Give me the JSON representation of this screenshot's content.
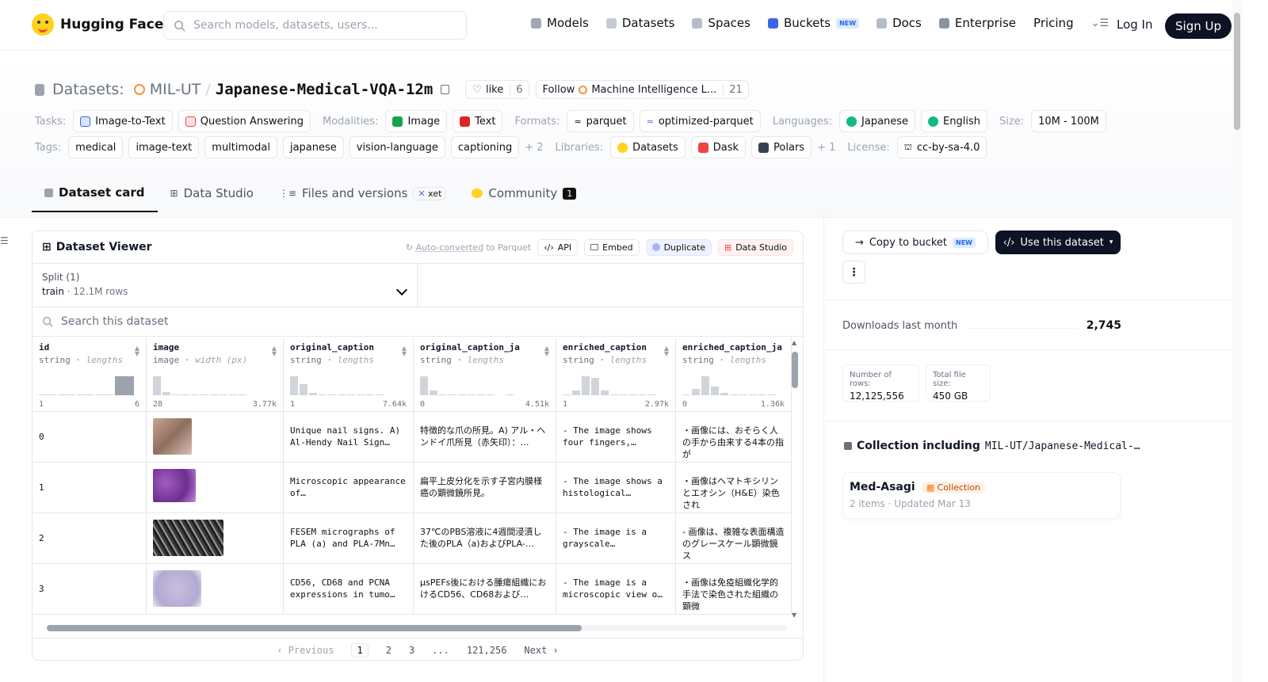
{
  "nav": {
    "brand": "Hugging Face",
    "search_placeholder": "Search models, datasets, users...",
    "links": [
      "Models",
      "Datasets",
      "Spaces",
      "Buckets",
      "Docs",
      "Enterprise",
      "Pricing"
    ],
    "buckets_badge": "NEW",
    "login": "Log In",
    "signup": "Sign Up"
  },
  "header": {
    "prefix": "Datasets:",
    "org": "MIL-UT",
    "sep": "/",
    "name": "Japanese-Medical-VQA-12m",
    "like_label": "like",
    "like_count": "6",
    "follow_label": "Follow",
    "follow_org": "Machine Intelligence L...",
    "follow_count": "21"
  },
  "meta_row1": {
    "tasks_label": "Tasks:",
    "tasks": [
      "Image-to-Text",
      "Question Answering"
    ],
    "modalities_label": "Modalities:",
    "modalities": [
      "Image",
      "Text"
    ],
    "formats_label": "Formats:",
    "formats": [
      "parquet",
      "optimized-parquet"
    ],
    "languages_label": "Languages:",
    "languages": [
      "Japanese",
      "English"
    ],
    "size_label": "Size:",
    "size": "10M - 100M"
  },
  "meta_row2": {
    "tags_label": "Tags:",
    "tags": [
      "medical",
      "image-text",
      "multimodal",
      "japanese",
      "vision-language",
      "captioning"
    ],
    "tags_more": "+ 2",
    "libraries_label": "Libraries:",
    "libraries": [
      "Datasets",
      "Dask",
      "Polars"
    ],
    "libraries_more": "+ 1",
    "license_label": "License:",
    "license": "cc-by-sa-4.0"
  },
  "tabs": {
    "dataset_card": "Dataset card",
    "data_studio": "Data Studio",
    "files": "Files and versions",
    "xet": "xet",
    "community": "Community",
    "community_count": "1"
  },
  "viewer": {
    "title": "Dataset Viewer",
    "auto_converted": "Auto-converted",
    "to_parquet": "to Parquet",
    "actions": [
      "API",
      "Embed",
      "Duplicate",
      "Data Studio"
    ],
    "split_label": "Split (1)",
    "split_name": "train",
    "split_rows": "12.1M rows",
    "search_placeholder": "Search this dataset",
    "columns": [
      {
        "name": "id",
        "type": "string",
        "stat": "lengths",
        "min": "1",
        "max": "6"
      },
      {
        "name": "image",
        "type": "image",
        "stat": "width (px)",
        "min": "28",
        "max": "3.77k"
      },
      {
        "name": "original_caption",
        "type": "string",
        "stat": "lengths",
        "min": "1",
        "max": "7.64k"
      },
      {
        "name": "original_caption_ja",
        "type": "string",
        "stat": "lengths",
        "min": "0",
        "max": "4.51k"
      },
      {
        "name": "enriched_caption",
        "type": "string",
        "stat": "lengths",
        "min": "1",
        "max": "2.97k"
      },
      {
        "name": "enriched_caption_ja",
        "type": "string",
        "stat": "lengths",
        "min": "0",
        "max": "1.36k"
      }
    ],
    "rows": [
      {
        "id": "0",
        "oc": "Unique nail signs. A) Al-Hendy Nail Sign…",
        "ocja": "特徴的な爪の所見。A) アル・ヘンドイ爪所見（赤矢印）：…",
        "ec": "- The image shows four fingers,…",
        "ecja": "・画像には、おそらく人の手から由来する4本の指が"
      },
      {
        "id": "1",
        "oc": "Microscopic appearance of…",
        "ocja": "扁平上皮分化を示す子宮内膜様癌の顕微鏡所見。",
        "ec": "- The image shows a histological…",
        "ecja": "・画像はヘマトキシリンとエオシン（H&E）染色され"
      },
      {
        "id": "2",
        "oc": "FESEM micrographs of PLA (a) and PLA-7Mn…",
        "ocja": "37℃のPBS溶液に4週間浸漬した後のPLA（a)およびPLA-…",
        "ec": "- The image is a grayscale…",
        "ecja": "- 画像は、複雑な表面構造のグレースケール顕微鏡ス"
      },
      {
        "id": "3",
        "oc": "CD56, CD68 and PCNA expressions in tumo…",
        "ocja": "µsPEFs後における腫瘍組織におけるCD56、CD68および…",
        "ec": "- The image is a microscopic view o…",
        "ecja": "・画像は免疫組織化学的手法で染色された組織の顕微"
      }
    ],
    "pager": {
      "prev": "Previous",
      "pages": [
        "1",
        "2",
        "3",
        "...",
        "121,256"
      ],
      "next": "Next"
    }
  },
  "sidebar": {
    "copy_bucket": "Copy to bucket",
    "copy_badge": "NEW",
    "use_dataset": "Use this dataset",
    "downloads_label": "Downloads last month",
    "downloads_value": "2,745",
    "rows_label": "Number of rows:",
    "rows_value": "12,125,556",
    "size_label": "Total file size:",
    "size_value": "450 GB",
    "collection_label": "Collection including",
    "collection_ref": "MIL-UT/Japanese-Medical-…",
    "collection_name": "Med-Asagi",
    "collection_badge": "Collection",
    "collection_meta": "2 items · Updated Mar 13"
  },
  "colors": {
    "accent_dark": "#0b1324",
    "hf_yellow": "#ffd21e"
  }
}
